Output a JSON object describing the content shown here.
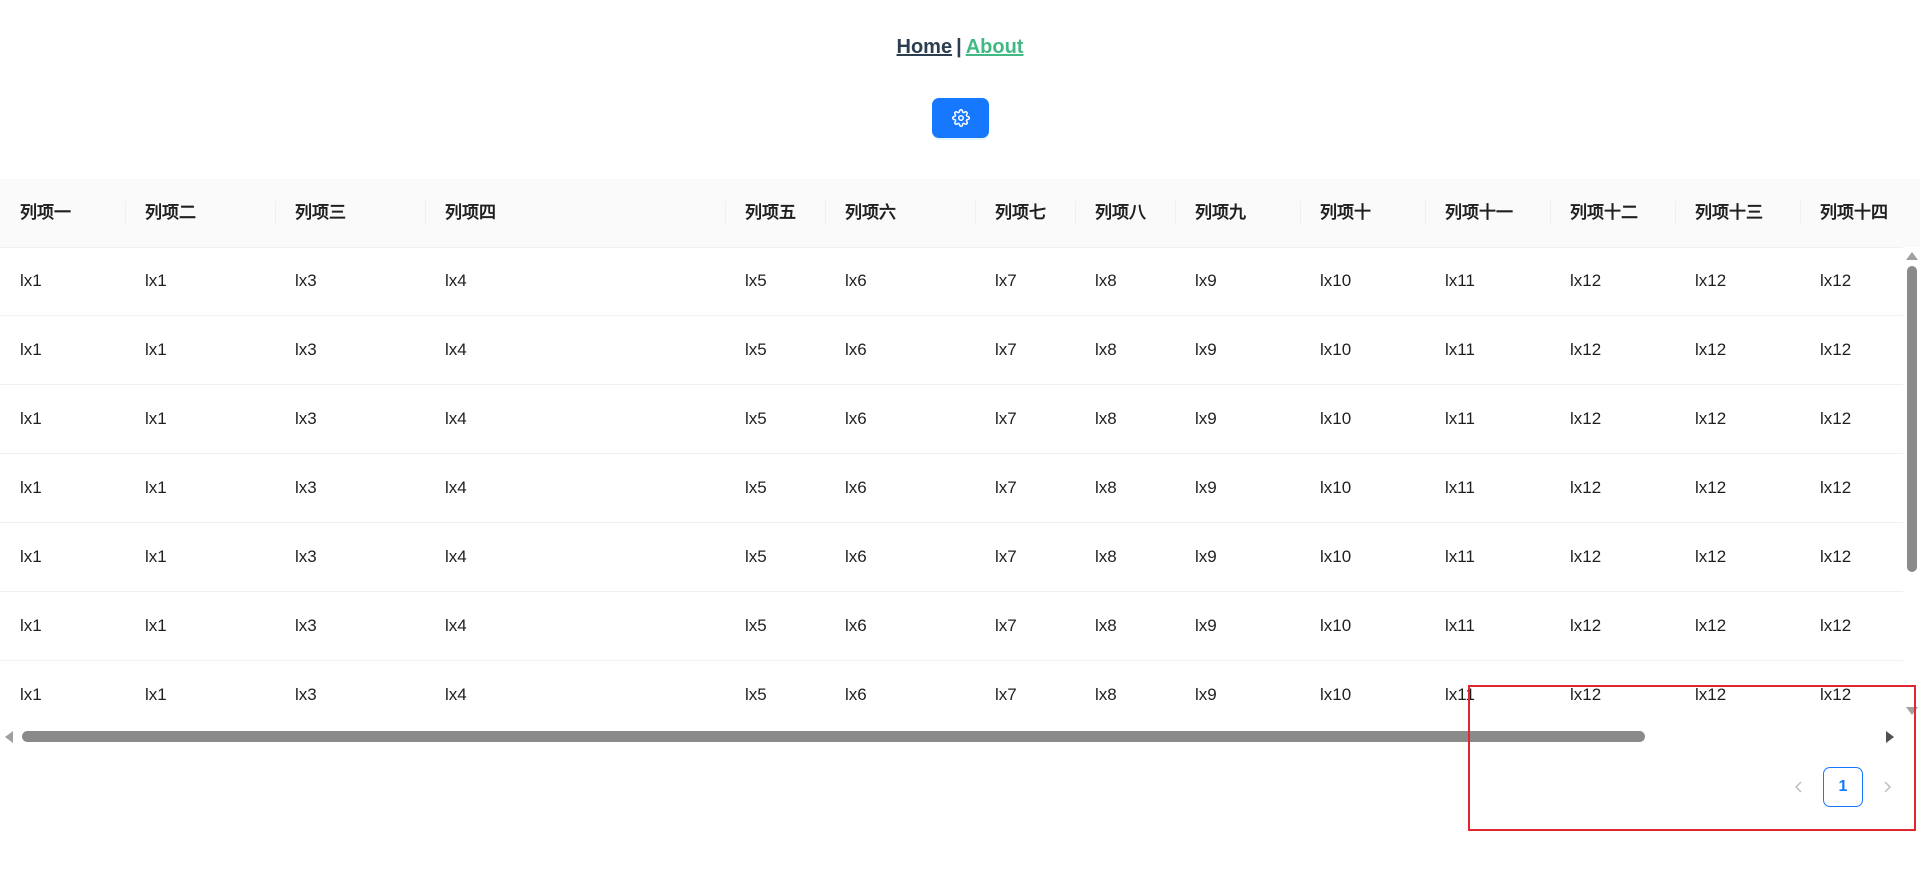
{
  "nav": {
    "home_label": "Home",
    "separator": "|",
    "about_label": "About"
  },
  "settings_button": {
    "icon": "gear-icon",
    "color": "#1677ff"
  },
  "table": {
    "columns": [
      "列项一",
      "列项二",
      "列项三",
      "列项四",
      "列项五",
      "列项六",
      "列项七",
      "列项八",
      "列项九",
      "列项十",
      "列项十一",
      "列项十二",
      "列项十三",
      "列项十四"
    ],
    "rows": [
      [
        "lx1",
        "lx1",
        "lx3",
        "lx4",
        "lx5",
        "lx6",
        "lx7",
        "lx8",
        "lx9",
        "lx10",
        "lx11",
        "lx12",
        "lx12",
        "lx12"
      ],
      [
        "lx1",
        "lx1",
        "lx3",
        "lx4",
        "lx5",
        "lx6",
        "lx7",
        "lx8",
        "lx9",
        "lx10",
        "lx11",
        "lx12",
        "lx12",
        "lx12"
      ],
      [
        "lx1",
        "lx1",
        "lx3",
        "lx4",
        "lx5",
        "lx6",
        "lx7",
        "lx8",
        "lx9",
        "lx10",
        "lx11",
        "lx12",
        "lx12",
        "lx12"
      ],
      [
        "lx1",
        "lx1",
        "lx3",
        "lx4",
        "lx5",
        "lx6",
        "lx7",
        "lx8",
        "lx9",
        "lx10",
        "lx11",
        "lx12",
        "lx12",
        "lx12"
      ],
      [
        "lx1",
        "lx1",
        "lx3",
        "lx4",
        "lx5",
        "lx6",
        "lx7",
        "lx8",
        "lx9",
        "lx10",
        "lx11",
        "lx12",
        "lx12",
        "lx12"
      ],
      [
        "lx1",
        "lx1",
        "lx3",
        "lx4",
        "lx5",
        "lx6",
        "lx7",
        "lx8",
        "lx9",
        "lx10",
        "lx11",
        "lx12",
        "lx12",
        "lx12"
      ],
      [
        "lx1",
        "lx1",
        "lx3",
        "lx4",
        "lx5",
        "lx6",
        "lx7",
        "lx8",
        "lx9",
        "lx10",
        "lx11",
        "lx12",
        "lx12",
        "lx12"
      ]
    ]
  },
  "pagination": {
    "prev_icon": "chevron-left-icon",
    "current_page": "1",
    "next_icon": "chevron-right-icon"
  },
  "colors": {
    "nav_home": "#2c3e50",
    "nav_about": "#42b983",
    "primary": "#1677ff",
    "highlight": "#e0262e"
  }
}
